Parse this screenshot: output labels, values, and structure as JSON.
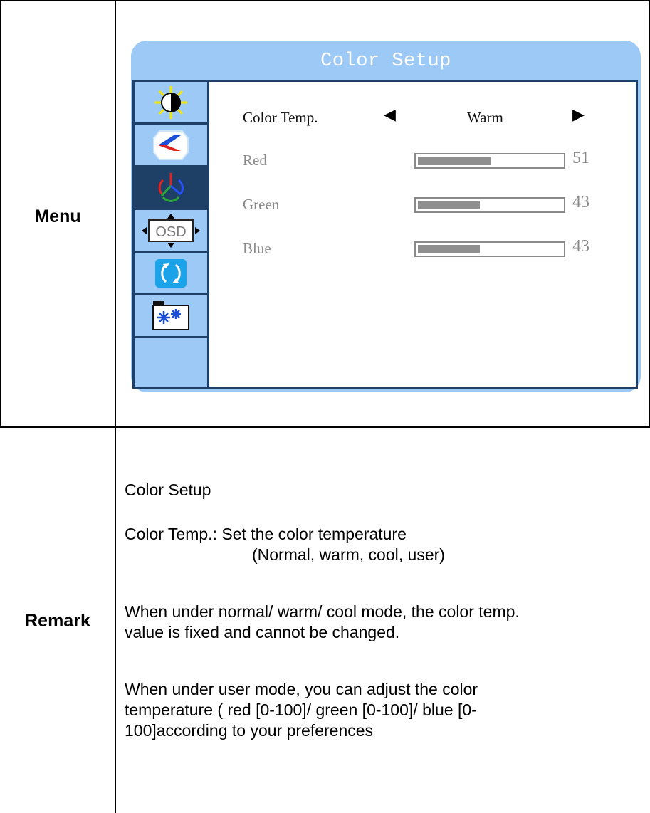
{
  "table": {
    "menu_label": "Menu",
    "remark_label": "Remark"
  },
  "osd": {
    "title": "Color Setup",
    "nav_icons": [
      "brightness-contrast-icon",
      "image-setup-icon",
      "color-setup-icon",
      "osd-position-icon",
      "reset-icon",
      "misc-settings-icon"
    ],
    "nav_icon_osd_text": "OSD",
    "active_index": 2,
    "color_temp": {
      "label": "Color Temp.",
      "value": "Warm"
    },
    "channels": [
      {
        "name": "Red",
        "value": 51
      },
      {
        "name": "Green",
        "value": 43
      },
      {
        "name": "Blue",
        "value": 43
      }
    ],
    "colors": {
      "panel": "#9cc9f5",
      "frame": "#1e3f66",
      "bar_fill": "#8f8f8f"
    }
  },
  "remark": {
    "heading": "Color Setup",
    "line1": "Color Temp.: Set the color temperature",
    "line2": "(Normal, warm, cool, user)",
    "para2_line1": "When under normal/ warm/ cool mode, the color temp.",
    "para2_line2": "value is fixed and cannot be changed.",
    "para3_line1": "When under user mode,  you can adjust the color",
    "para3_line2": "temperature ( red [0-100]/ green [0-100]/ blue [0-",
    "para3_line3": "100]according to your preferences"
  }
}
